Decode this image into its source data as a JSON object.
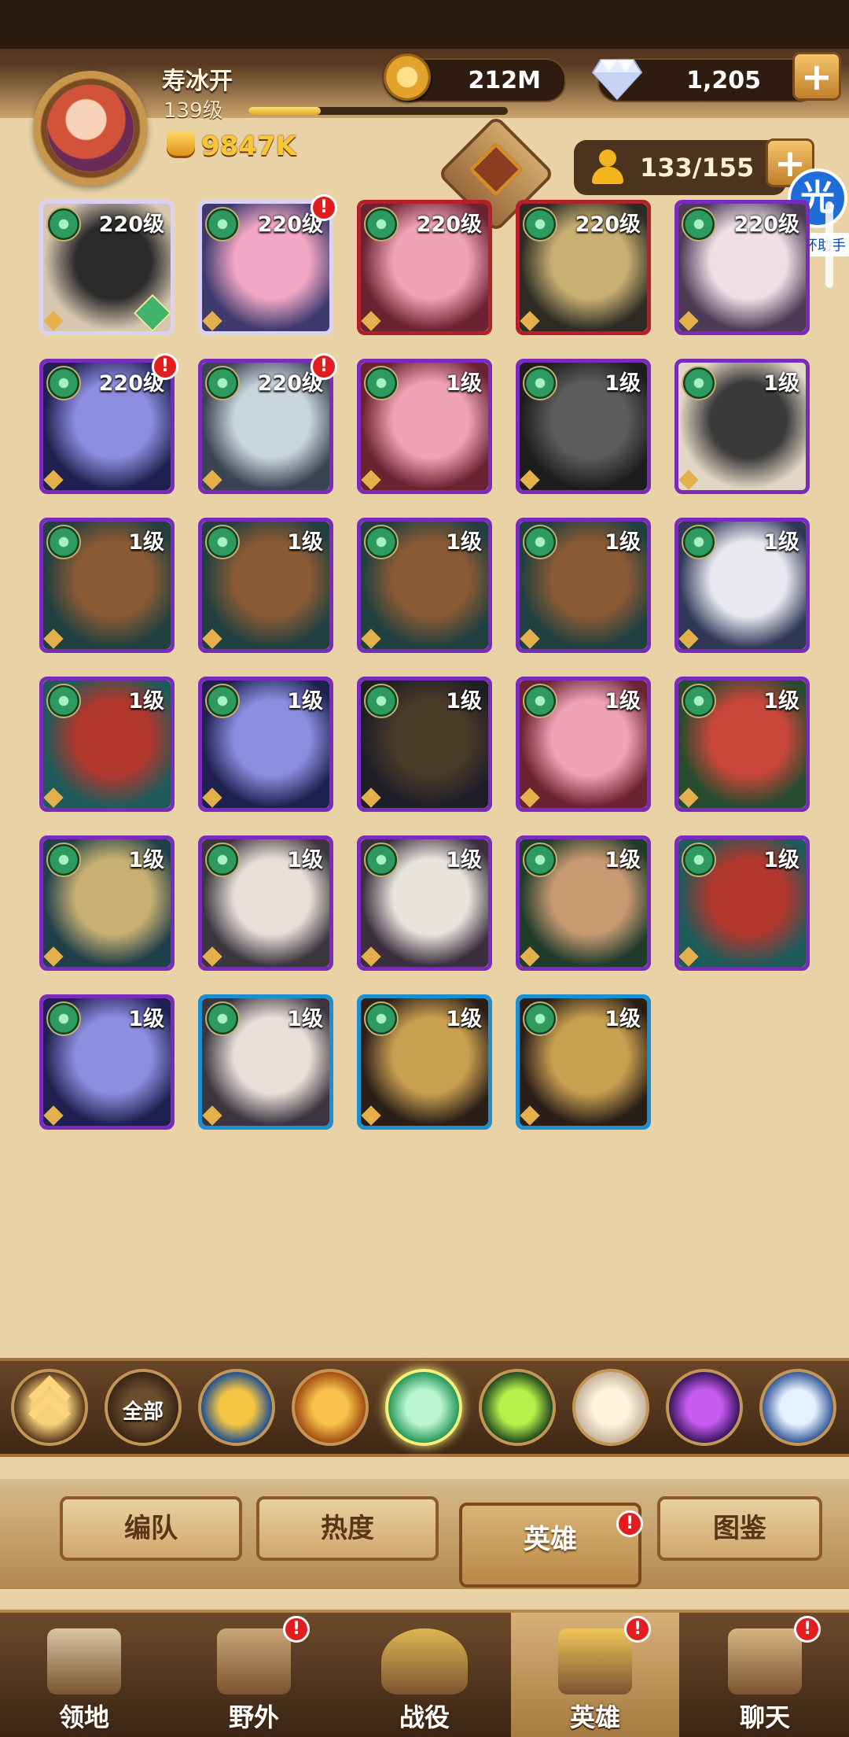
{
  "player": {
    "name": "寿冰开",
    "level": "139级",
    "xp_progress": 0.28,
    "power": "9847K"
  },
  "resources": {
    "gold": "212M",
    "gems": "1,205"
  },
  "roster": {
    "capacity": "133/155"
  },
  "helper": {
    "icon_text": "光",
    "label": "光环助手"
  },
  "heroes": [
    {
      "level": "220级",
      "frame": "#d9d2f5",
      "art": [
        "#2b2a2a",
        "#d7c7b0"
      ],
      "alert": false,
      "hourglass": true
    },
    {
      "level": "220级",
      "frame": "#d9d2f5",
      "art": [
        "#f2a7c4",
        "#3e3a6e"
      ],
      "alert": true,
      "hourglass": false
    },
    {
      "level": "220级",
      "frame": "#b3202a",
      "art": [
        "#f0a3b7",
        "#6b2231"
      ],
      "alert": false,
      "hourglass": false
    },
    {
      "level": "220级",
      "frame": "#b3202a",
      "art": [
        "#c9b072",
        "#2d2b24"
      ],
      "alert": false,
      "hourglass": false
    },
    {
      "level": "220级",
      "frame": "#7a2bbd",
      "art": [
        "#f0e0e6",
        "#4d3b56"
      ],
      "alert": false,
      "hourglass": false
    },
    {
      "level": "220级",
      "frame": "#7a2bbd",
      "art": [
        "#8d8ee0",
        "#1f2050"
      ],
      "alert": true,
      "hourglass": false
    },
    {
      "level": "220级",
      "frame": "#7a2bbd",
      "art": [
        "#c9d5dd",
        "#3b4453"
      ],
      "alert": true,
      "hourglass": false
    },
    {
      "level": "1级",
      "frame": "#7a2bbd",
      "art": [
        "#f0a3b7",
        "#6b2231"
      ],
      "alert": false,
      "hourglass": false
    },
    {
      "level": "1级",
      "frame": "#7a2bbd",
      "art": [
        "#5c5c5c",
        "#1c1c1c"
      ],
      "alert": false,
      "hourglass": false
    },
    {
      "level": "1级",
      "frame": "#7a2bbd",
      "art": [
        "#3a3a3a",
        "#e2d6c4"
      ],
      "alert": false,
      "hourglass": false
    },
    {
      "level": "1级",
      "frame": "#7a2bbd",
      "art": [
        "#8a5a34",
        "#1f3f40"
      ],
      "alert": false,
      "hourglass": false
    },
    {
      "level": "1级",
      "frame": "#7a2bbd",
      "art": [
        "#8a5a34",
        "#1f3f40"
      ],
      "alert": false,
      "hourglass": false
    },
    {
      "level": "1级",
      "frame": "#7a2bbd",
      "art": [
        "#8a5a34",
        "#1f3f40"
      ],
      "alert": false,
      "hourglass": false
    },
    {
      "level": "1级",
      "frame": "#7a2bbd",
      "art": [
        "#8a5a34",
        "#1f3f40"
      ],
      "alert": false,
      "hourglass": false
    },
    {
      "level": "1级",
      "frame": "#7a2bbd",
      "art": [
        "#e8e8ef",
        "#2f3857"
      ],
      "alert": false,
      "hourglass": false
    },
    {
      "level": "1级",
      "frame": "#7a2bbd",
      "art": [
        "#b2372d",
        "#1f5a5a"
      ],
      "alert": false,
      "hourglass": false
    },
    {
      "level": "1级",
      "frame": "#7a2bbd",
      "art": [
        "#8d8ee0",
        "#1f2050"
      ],
      "alert": false,
      "hourglass": false
    },
    {
      "level": "1级",
      "frame": "#7a2bbd",
      "art": [
        "#4a3a28",
        "#1e1e28"
      ],
      "alert": false,
      "hourglass": false
    },
    {
      "level": "1级",
      "frame": "#7a2bbd",
      "art": [
        "#f0a3b7",
        "#6b2231"
      ],
      "alert": false,
      "hourglass": false
    },
    {
      "level": "1级",
      "frame": "#7a2bbd",
      "art": [
        "#c9463a",
        "#264b2e"
      ],
      "alert": false,
      "hourglass": false
    },
    {
      "level": "1级",
      "frame": "#7a2bbd",
      "art": [
        "#c9b072",
        "#1f3f4a"
      ],
      "alert": false,
      "hourglass": false
    },
    {
      "level": "1级",
      "frame": "#7a2bbd",
      "art": [
        "#e8e0d8",
        "#3b3540"
      ],
      "alert": false,
      "hourglass": false
    },
    {
      "level": "1级",
      "frame": "#7a2bbd",
      "art": [
        "#e8e4dc",
        "#3a2e3e"
      ],
      "alert": false,
      "hourglass": false
    },
    {
      "level": "1级",
      "frame": "#7a2bbd",
      "art": [
        "#c99a72",
        "#1f3b2a"
      ],
      "alert": false,
      "hourglass": false
    },
    {
      "level": "1级",
      "frame": "#7a2bbd",
      "art": [
        "#b2372d",
        "#1f5a5a"
      ],
      "alert": false,
      "hourglass": false
    },
    {
      "level": "1级",
      "frame": "#7a2bbd",
      "art": [
        "#8d8ee0",
        "#1f2050"
      ],
      "alert": false,
      "hourglass": false
    },
    {
      "level": "1级",
      "frame": "#1a8fd1",
      "art": [
        "#e8e0d8",
        "#3b3540"
      ],
      "alert": false,
      "hourglass": false
    },
    {
      "level": "1级",
      "frame": "#1a8fd1",
      "art": [
        "#c9a050",
        "#2a1e18"
      ],
      "alert": false,
      "hourglass": false
    },
    {
      "level": "1级",
      "frame": "#1a8fd1",
      "art": [
        "#c9a050",
        "#2a1e18"
      ],
      "alert": false,
      "hourglass": false
    }
  ],
  "factions": [
    {
      "name": "rank-sort-icon",
      "label": "",
      "colors": [
        "#f5d27a",
        "#5a3a1e"
      ]
    },
    {
      "name": "faction-all-icon",
      "label": "全部",
      "colors": [
        "#6b4d2e",
        "#3a2617"
      ]
    },
    {
      "name": "lightbearer-icon",
      "label": "",
      "colors": [
        "#f4c542",
        "#23528f"
      ]
    },
    {
      "name": "mauler-icon",
      "label": "",
      "colors": [
        "#f7c14b",
        "#a44f12"
      ]
    },
    {
      "name": "wilder-icon",
      "label": "",
      "colors": [
        "#baf5d0",
        "#2a9a5a"
      ]
    },
    {
      "name": "graveborn-icon",
      "label": "",
      "colors": [
        "#b7f04a",
        "#234a1f"
      ]
    },
    {
      "name": "celestial-icon",
      "label": "",
      "colors": [
        "#fff5dc",
        "#c8b6a0"
      ]
    },
    {
      "name": "hypogean-icon",
      "label": "",
      "colors": [
        "#c65cf0",
        "#3b1660"
      ]
    },
    {
      "name": "dimensional-icon",
      "label": "",
      "colors": [
        "#e4f1ff",
        "#3a5c9c"
      ]
    }
  ],
  "subtabs": [
    {
      "label": "编队",
      "active": false
    },
    {
      "label": "热度",
      "active": false
    },
    {
      "label": "英雄",
      "active": true,
      "alert": true
    },
    {
      "label": "图鉴",
      "active": false
    }
  ],
  "nav": [
    {
      "label": "领地",
      "icon": "castle-icon",
      "active": false,
      "alert": false
    },
    {
      "label": "野外",
      "icon": "map-scroll-icon",
      "active": false,
      "alert": true
    },
    {
      "label": "战役",
      "icon": "campaign-sword-icon",
      "active": false,
      "alert": false
    },
    {
      "label": "英雄",
      "icon": "hero-helmet-icon",
      "active": true,
      "alert": true
    },
    {
      "label": "聊天",
      "icon": "chat-bubble-icon",
      "active": false,
      "alert": true
    }
  ],
  "alert_mark": "!",
  "plus_mark": "+"
}
